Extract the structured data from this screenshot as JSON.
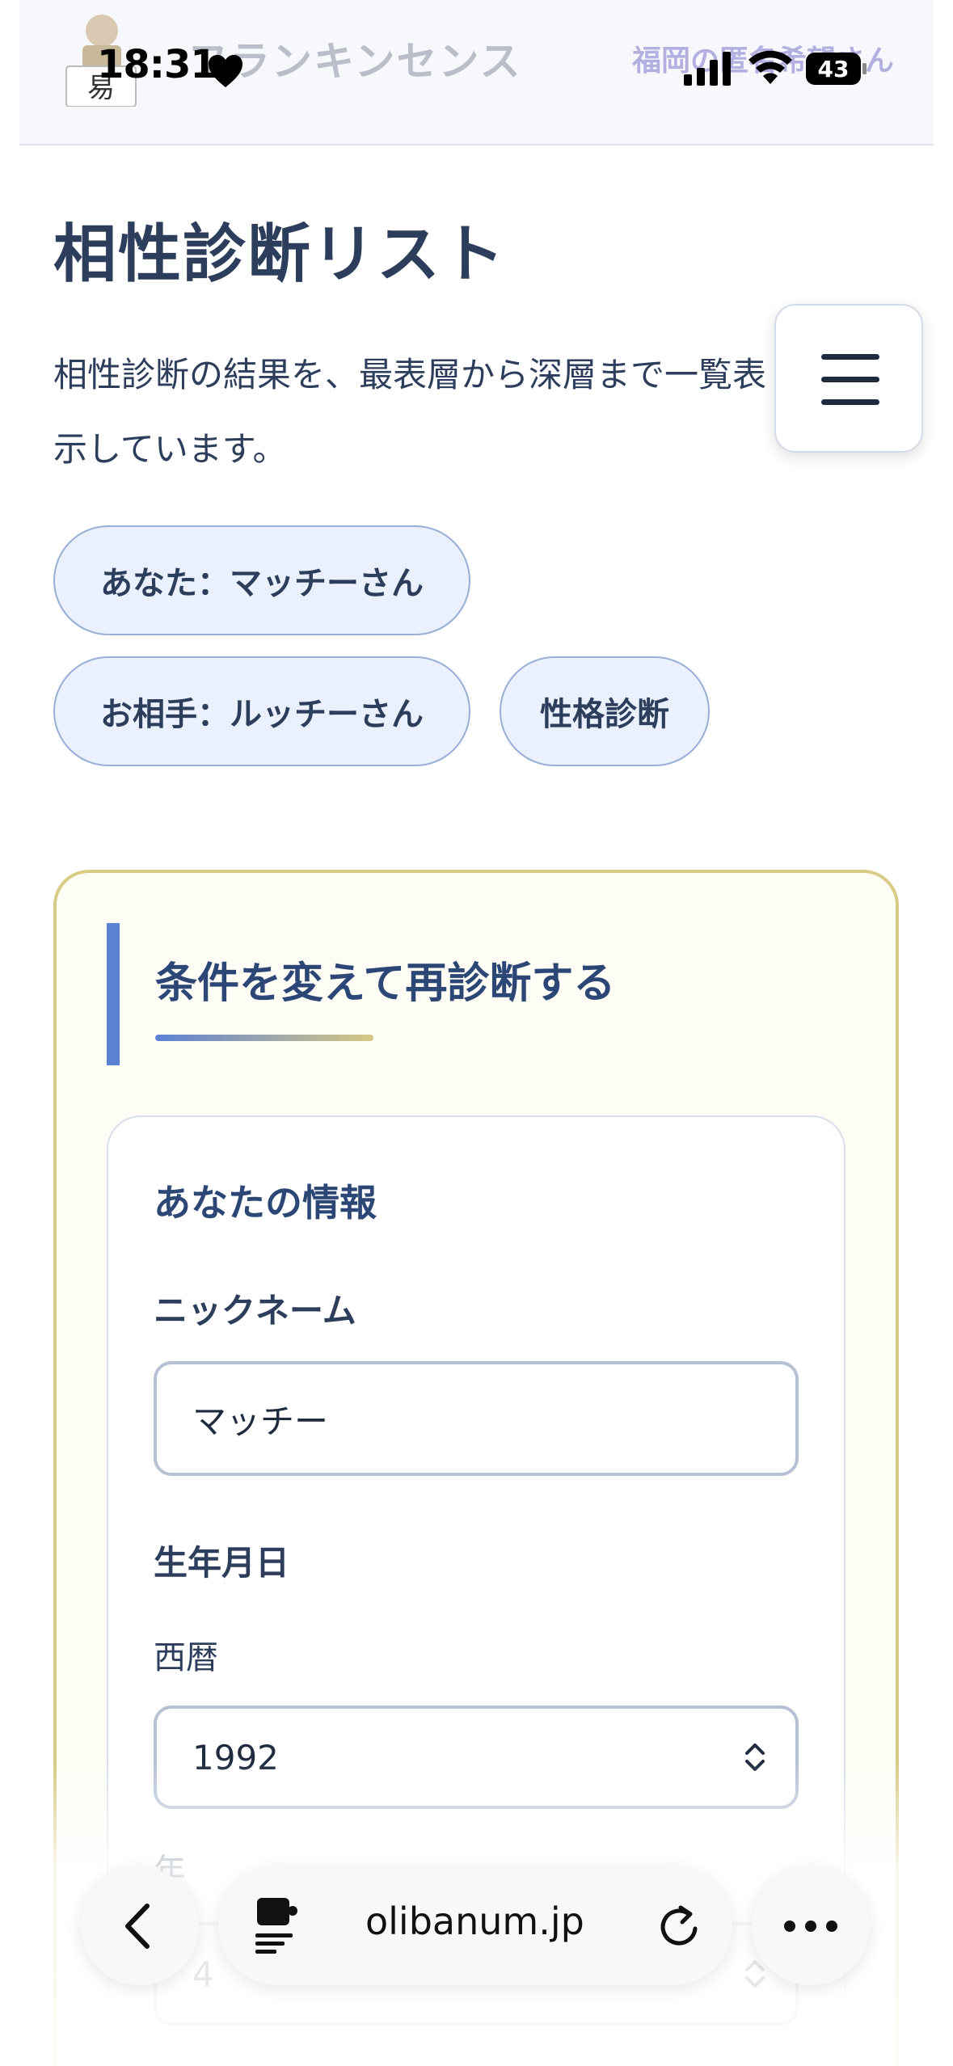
{
  "site": {
    "title": "フランキンセンス",
    "user": "福岡の匿名希望さん",
    "logo_char": "易"
  },
  "status_bar": {
    "time": "18:31",
    "battery": "43"
  },
  "page": {
    "title": "相性診断リスト",
    "description": "相性診断の結果を、最表層から深層まで一覧表示しています。"
  },
  "tags": [
    {
      "label": "あなた：マッチーさん"
    },
    {
      "label": "お相手：ルッチーさん"
    },
    {
      "label": "性格診断"
    }
  ],
  "rediagnose": {
    "title": "条件を変えて再診断する",
    "section_title": "あなたの情報",
    "nickname_label": "ニックネーム",
    "nickname_value": "マッチー",
    "birthdate_label": "生年月日",
    "year_label": "西暦",
    "year_value": "1992",
    "month_label": "年",
    "month_value": "4"
  },
  "browser": {
    "url": "olibanum.jp"
  },
  "icons": {
    "menu": "hamburger-icon",
    "back": "chevron-left-icon",
    "extension": "puzzle-icon",
    "reload": "reload-icon",
    "more": "more-icon"
  },
  "colors": {
    "tag_bg": "#eaf1fd",
    "tag_border": "#97afd6",
    "panel_border": "#d7cb85",
    "accent_blue": "#5c81d4",
    "text_dark": "#2c3e5c"
  }
}
